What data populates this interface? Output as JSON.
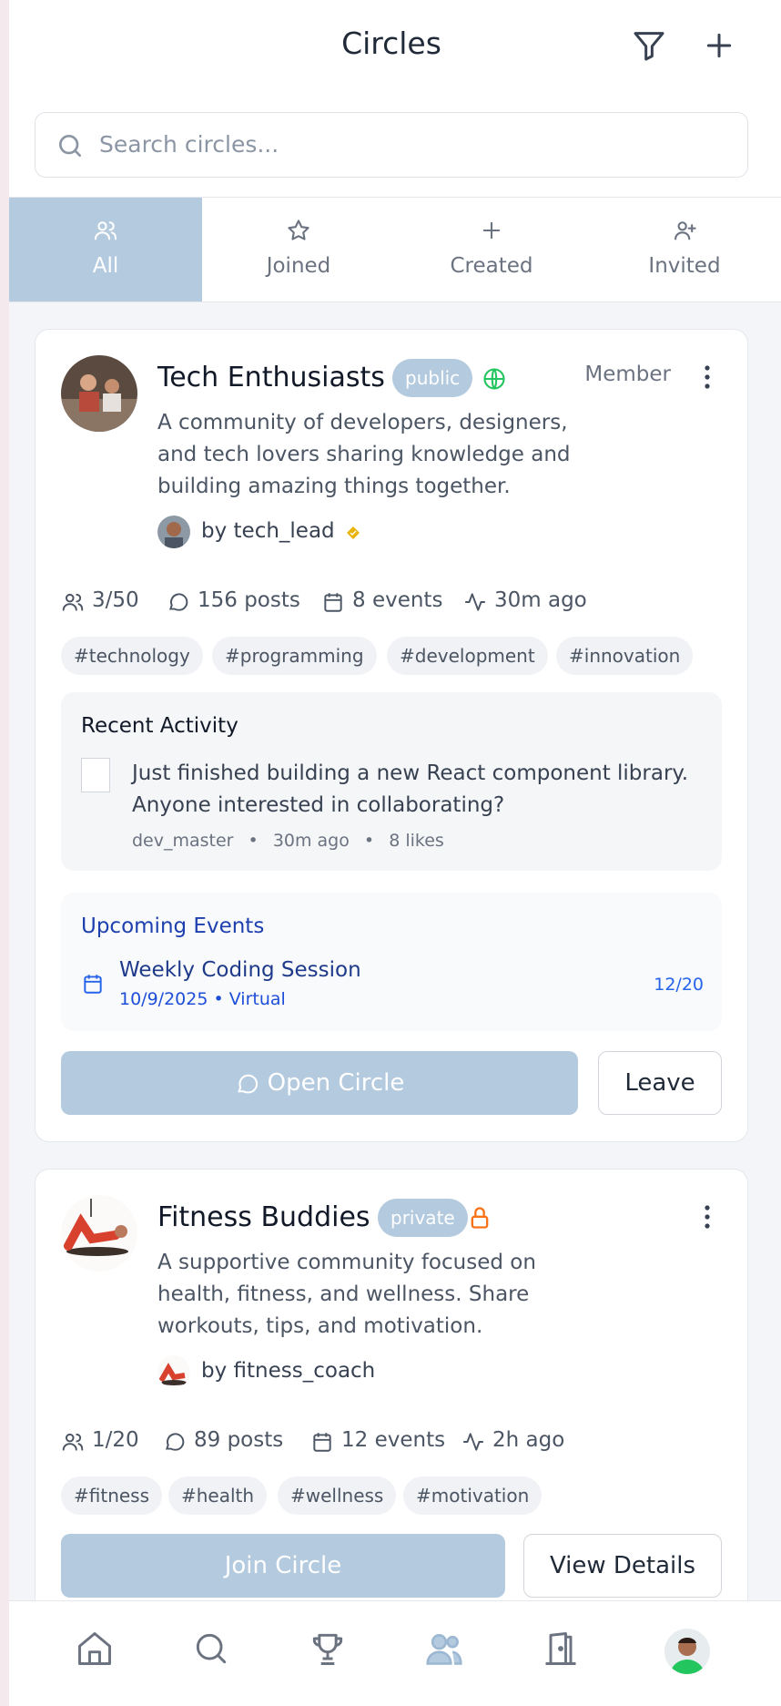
{
  "header": {
    "title": "Circles",
    "filter_icon": "filter-icon",
    "add_icon": "plus-icon"
  },
  "search": {
    "placeholder": "Search circles..."
  },
  "tabs": [
    {
      "label": "All",
      "icon": "users-icon",
      "active": true
    },
    {
      "label": "Joined",
      "icon": "star-icon",
      "active": false
    },
    {
      "label": "Created",
      "icon": "plus-icon",
      "active": false
    },
    {
      "label": "Invited",
      "icon": "user-plus-icon",
      "active": false
    }
  ],
  "circles": [
    {
      "name": "Tech Enthusiasts",
      "visibility": "public",
      "visibility_icon": "globe-icon",
      "role": "Member",
      "description": "A community of developers, designers, and tech lovers sharing knowledge and building amazing things together.",
      "owner": "by tech_lead",
      "stats": {
        "members": "3/50",
        "posts": "156 posts",
        "events": "8 events",
        "activity": "30m ago"
      },
      "tags": [
        "#technology",
        "#programming",
        "#development",
        "#innovation"
      ],
      "recent_activity": {
        "heading": "Recent Activity",
        "text": "Just finished building a new React component library. Anyone interested in collaborating?",
        "author": "dev_master",
        "time": "30m ago",
        "likes": "8 likes"
      },
      "upcoming_events": {
        "heading": "Upcoming Events",
        "name": "Weekly Coding Session",
        "details": "10/9/2025 • Virtual",
        "capacity": "12/20"
      },
      "primary_action": "Open Circle",
      "secondary_action": "Leave"
    },
    {
      "name": "Fitness Buddies",
      "visibility": "private",
      "visibility_icon": "lock-icon",
      "description": "A supportive community focused on health, fitness, and wellness. Share workouts, tips, and motivation.",
      "owner": "by fitness_coach",
      "stats": {
        "members": "1/20",
        "posts": "89 posts",
        "events": "12 events",
        "activity": "2h ago"
      },
      "tags": [
        "#fitness",
        "#health",
        "#wellness",
        "#motivation"
      ],
      "primary_action": "Join Circle",
      "secondary_action": "View Details"
    }
  ],
  "bottom_nav": [
    "home-icon",
    "search-icon",
    "trophy-icon",
    "users-icon",
    "door-icon",
    "profile-avatar"
  ],
  "colors": {
    "accent": "#b3cadf",
    "public_globe": "#22c55e",
    "private_lock": "#f97316",
    "event_blue": "#1e40af"
  }
}
